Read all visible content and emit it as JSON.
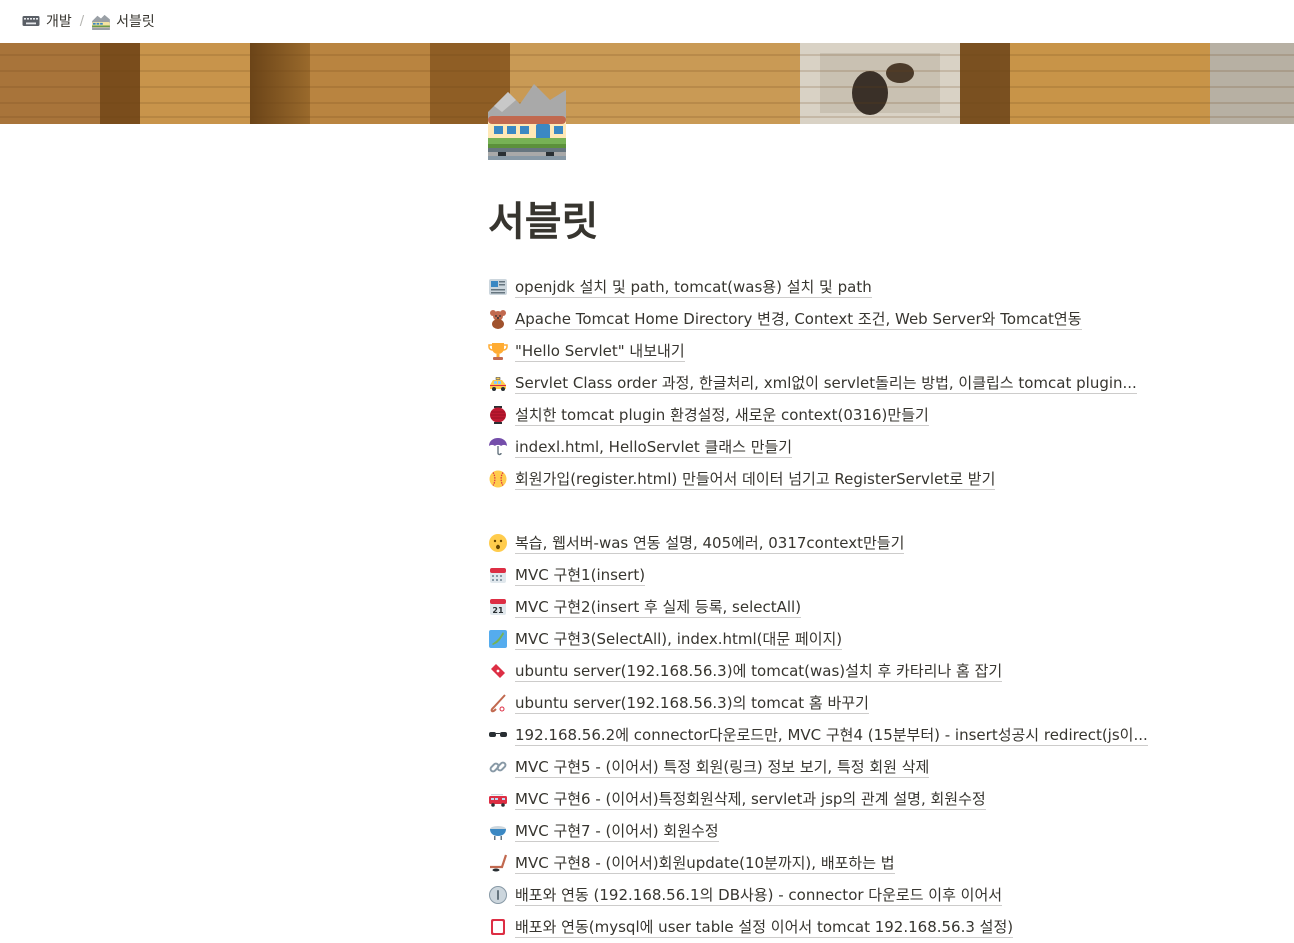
{
  "breadcrumb": {
    "items": [
      {
        "icon": "keyboard-icon",
        "label": "개발"
      },
      {
        "icon": "train-icon",
        "label": "서블릿"
      }
    ],
    "separator": "/"
  },
  "page": {
    "icon": "mountain-railway-icon",
    "title": "서블릿"
  },
  "links": [
    {
      "icon": "newspaper-icon",
      "label": "openjdk 설치 및 path, tomcat(was용) 설치 및 path"
    },
    {
      "icon": "teddy-bear-icon",
      "label": "Apache Tomcat Home Directory 변경, Context 조건, Web Server와 Tomcat연동"
    },
    {
      "icon": "trophy-icon",
      "label": "\"Hello Servlet\" 내보내기"
    },
    {
      "icon": "taxi-icon",
      "label": "Servlet Class order 과정, 한글처리, xml없이 servlet돌리는 방법, 이클립스 tomcat plugin..."
    },
    {
      "icon": "lantern-icon",
      "label": "설치한 tomcat plugin 환경설정, 새로운 context(0316)만들기"
    },
    {
      "icon": "umbrella-icon",
      "label": "indexl.html, HelloServlet 클래스 만들기"
    },
    {
      "icon": "baseball-icon",
      "label": "회원가입(register.html) 만들어서 데이터 넘기고 RegisterServlet로 받기"
    },
    {
      "icon": "",
      "label": ""
    },
    {
      "icon": "face-hushed-icon",
      "label": "복습, 웹서버-was 연동 설명, 405에러, 0317context만들기"
    },
    {
      "icon": "calendar-icon",
      "label": "MVC 구현1(insert)"
    },
    {
      "icon": "tear-off-calendar-icon",
      "label": "MVC 구현2(insert 후 실제 등록, selectAll)"
    },
    {
      "icon": "japan-map-icon",
      "label": "MVC 구현3(SelectAll), index.html(대문 페이지)"
    },
    {
      "icon": "ticket-icon",
      "label": "ubuntu server(192.168.56.3)에 tomcat(was)설치 후 카타리나 홈 잡기"
    },
    {
      "icon": "field-hockey-icon",
      "label": "ubuntu server(192.168.56.3)의 tomcat 홈 바꾸기"
    },
    {
      "icon": "sunglasses-icon",
      "label": "192.168.56.2에 connector다운로드만, MVC 구현4 (15분부터) - insert성공시 redirect(js이..."
    },
    {
      "icon": "link-icon",
      "label": "MVC 구현5 - (이어서) 특정 회원(링크) 정보 보기, 특정 회원 삭제"
    },
    {
      "icon": "fire-engine-icon",
      "label": "MVC 구현6 - (이어서)특정회원삭제, servlet과 jsp의 관계 설명, 회원수정"
    },
    {
      "icon": "fondue-icon",
      "label": "MVC 구현7 - (이어서) 회원수정"
    },
    {
      "icon": "ice-hockey-icon",
      "label": "MVC 구현8 - (이어서)회원update(10분까지), 배포하는 법"
    },
    {
      "icon": "info-circle-icon",
      "label": "배포와 연동 (192.168.56.1의 DB사용) - connector 다운로드 이후 이어서"
    },
    {
      "icon": "card-icon",
      "label": "배포와 연동(mysql에 user table 설정 이어서 tomcat 192.168.56.3 설정)"
    }
  ]
}
